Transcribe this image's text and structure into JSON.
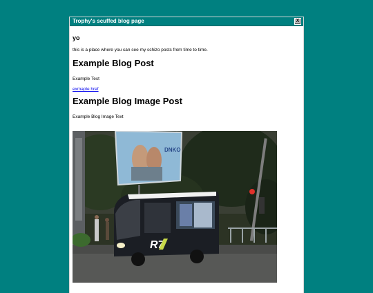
{
  "window": {
    "title": "Trophy's scuffed blog page",
    "close_label": "X"
  },
  "content": {
    "greeting": "yo",
    "intro": "this is a place where you can see my schizo posts from time to time.",
    "posts": [
      {
        "title": "Example Blog Post",
        "text": "Example Test",
        "link_text": "exmaple href"
      },
      {
        "title": "Example Blog Image Post",
        "text": "Example Blog Image Text"
      }
    ],
    "image_billboard_text": "DNKO",
    "image_bus_text": "R7"
  },
  "colors": {
    "desktop": "#008080",
    "titlebar": "#008080",
    "link": "#0000ee"
  }
}
